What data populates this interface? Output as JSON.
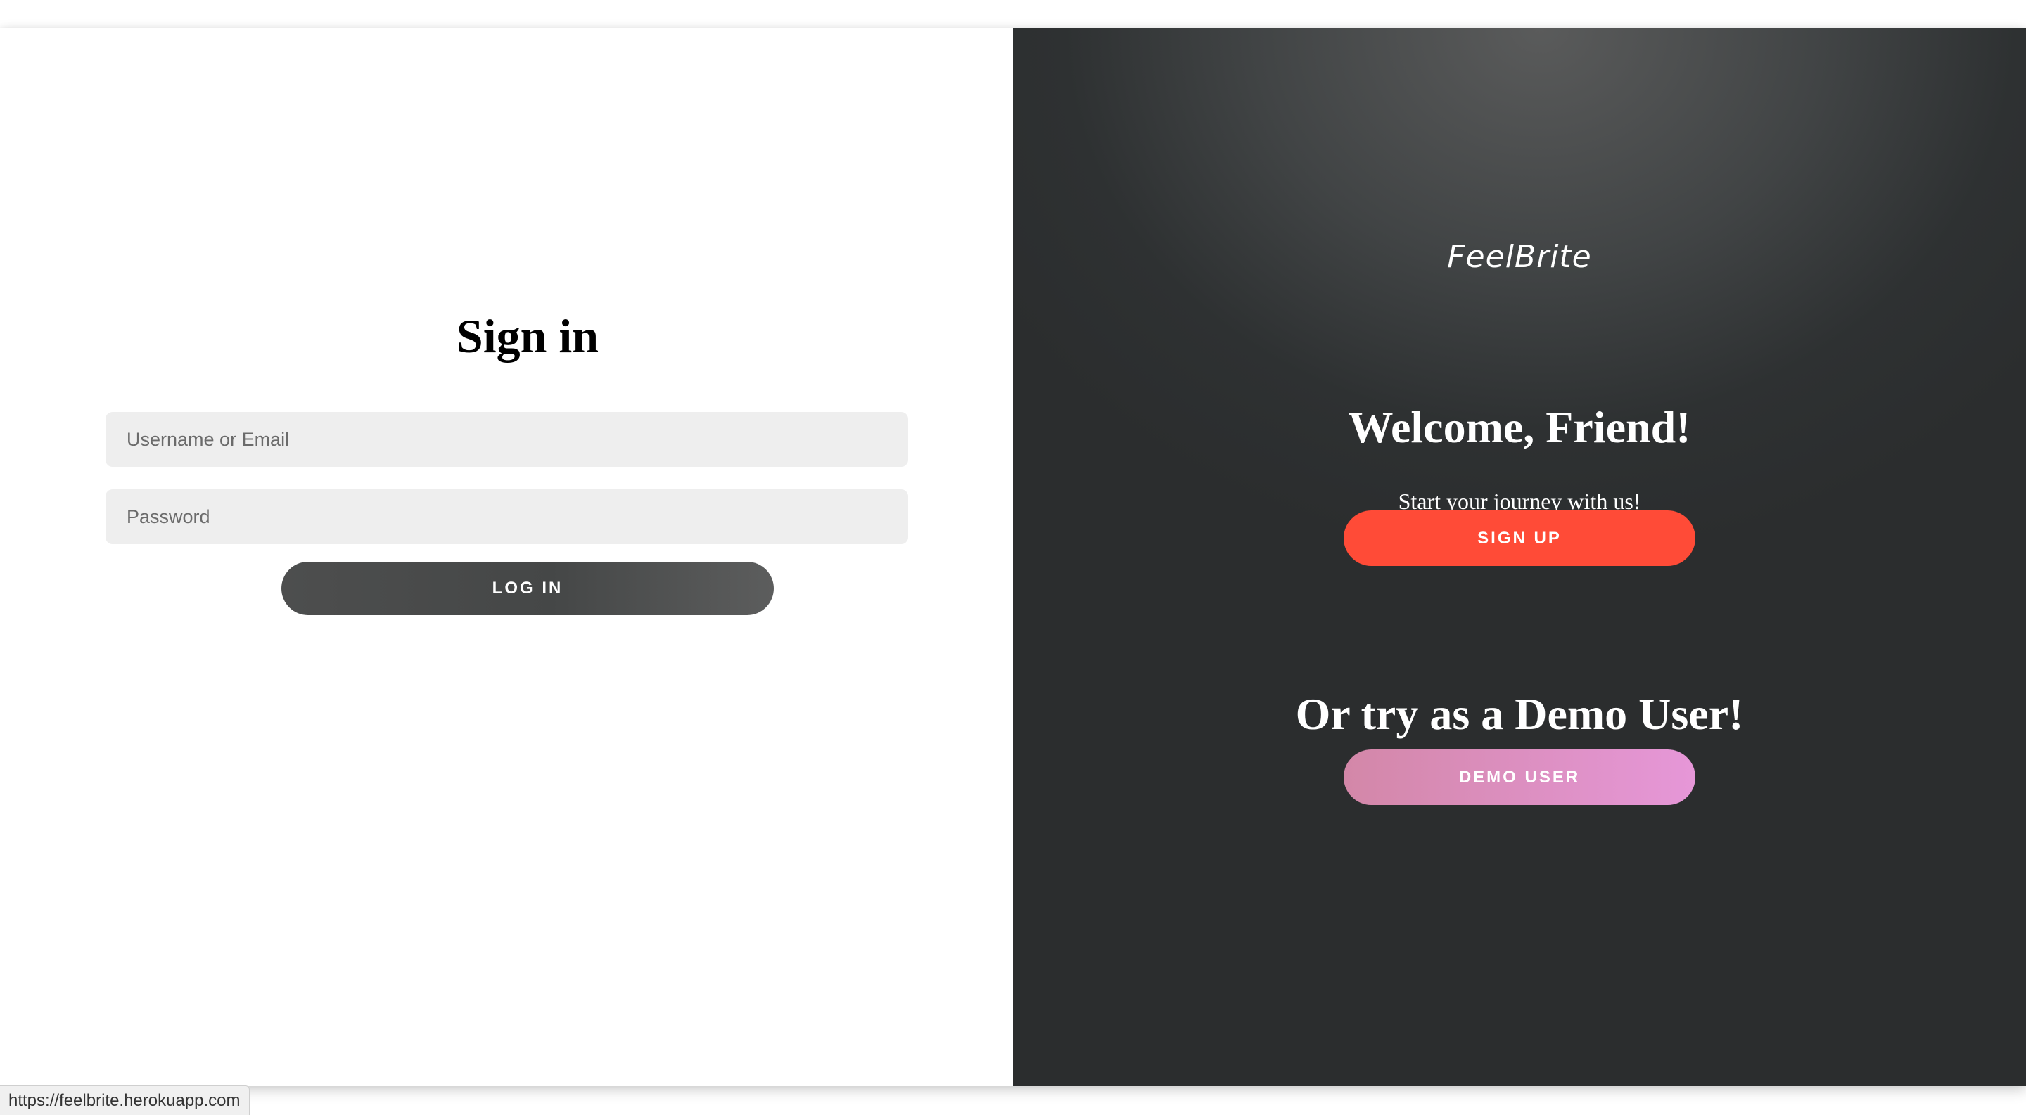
{
  "signin": {
    "title": "Sign in",
    "username_placeholder": "Username or Email",
    "password_placeholder": "Password",
    "login_label": "LOG IN"
  },
  "promo": {
    "logo": "FeelBrite",
    "welcome_title": "Welcome, Friend!",
    "tagline": "Start your journey with us!",
    "signup_label": "SIGN UP",
    "demo_title": "Or try as a Demo User!",
    "demo_label": "DEMO USER"
  },
  "status_bar": {
    "url": "https://feelbrite.herokuapp.com"
  },
  "colors": {
    "signup_button": "#ff4b37",
    "demo_button": "#dc8fc0",
    "login_button": "#4d4e4e",
    "panel_dark": "#2e3132"
  }
}
